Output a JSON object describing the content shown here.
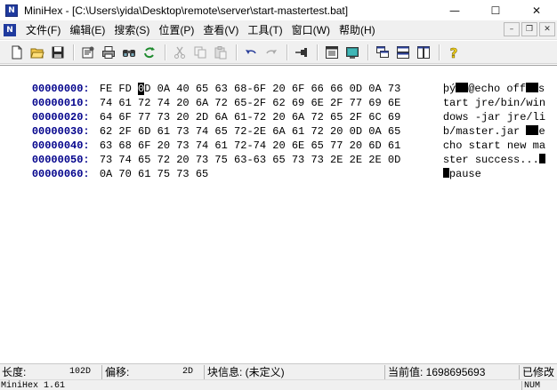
{
  "app": {
    "icon_letter": "N",
    "title": "MiniHex - [C:\\Users\\yida\\Desktop\\remote\\server\\start-mastertest.bat]",
    "controls": {
      "minimize": "—",
      "maximize": "☐",
      "close": "✕"
    }
  },
  "menu": {
    "items": [
      {
        "label": "文件(F)"
      },
      {
        "label": "编辑(E)"
      },
      {
        "label": "搜索(S)"
      },
      {
        "label": "位置(P)"
      },
      {
        "label": "查看(V)"
      },
      {
        "label": "工具(T)"
      },
      {
        "label": "窗口(W)"
      },
      {
        "label": "帮助(H)"
      }
    ],
    "mdi_controls": {
      "minimize": "–",
      "restore": "❐",
      "close": "✕"
    }
  },
  "toolbar": {
    "buttons": [
      {
        "icon": "new-file-icon"
      },
      {
        "icon": "open-folder-icon"
      },
      {
        "icon": "save-icon"
      },
      {
        "icon": "properties-icon"
      },
      {
        "icon": "print-icon"
      },
      {
        "icon": "find-icon"
      },
      {
        "icon": "refresh-icon"
      },
      {
        "icon": "cut-icon"
      },
      {
        "icon": "copy-icon"
      },
      {
        "icon": "paste-icon"
      },
      {
        "icon": "undo-icon"
      },
      {
        "icon": "redo-icon"
      },
      {
        "icon": "pin-icon"
      },
      {
        "icon": "view-list-icon"
      },
      {
        "icon": "display-icon"
      },
      {
        "icon": "cascade-icon"
      },
      {
        "icon": "tile-horizontal-icon"
      },
      {
        "icon": "tile-vertical-icon"
      },
      {
        "icon": "help-icon"
      }
    ]
  },
  "hex": {
    "rows": [
      {
        "offset": "00000000:",
        "bytes": "FE FD 0D 0A 40 65 63 68-6F 20 6F 66 66 0D 0A 73",
        "ascii": "@echo off",
        "ascii_end": "s"
      },
      {
        "offset": "00000010:",
        "bytes": "74 61 72 74 20 6A 72 65-2F 62 69 6E 2F 77 69 6E",
        "ascii": "tart jre/bin/win"
      },
      {
        "offset": "00000020:",
        "bytes": "64 6F 77 73 20 2D 6A 61-72 20 6A 72 65 2F 6C 69",
        "ascii": "dows -jar jre/li"
      },
      {
        "offset": "00000030:",
        "bytes": "62 2F 6D 61 73 74 65 72-2E 6A 61 72 20 0D 0A 65",
        "ascii": "b/master.jar ",
        "ascii_end": "e"
      },
      {
        "offset": "00000040:",
        "bytes": "63 68 6F 20 73 74 61 72-74 20 6E 65 77 20 6D 61",
        "ascii": "cho start new ma"
      },
      {
        "offset": "00000050:",
        "bytes": "73 74 65 72 20 73 75 63-63 65 73 73 2E 2E 2E 0D",
        "ascii": "ster success..."
      },
      {
        "offset": "00000060:",
        "bytes": "0A 70 61 75 73 65",
        "ascii": "pause"
      }
    ],
    "first_row": {
      "byte_1": "FE",
      "byte_2": "FD",
      "cursor_byte_head": "0",
      "cursor_byte_tail": "D",
      "bytes_rest": "0A 40 65 63 68-6F 20 6F 66 66 0D 0A 73",
      "ascii_1": "þ",
      "ascii_2": "ý"
    }
  },
  "status": {
    "length_label": "长度:",
    "length_value": "102D",
    "offset_label": "偏移:",
    "offset_value": "2D",
    "block_label": "块信息: (未定义)",
    "current_label": "当前值: 1698695693",
    "modified_label": "已修改"
  },
  "status2": {
    "version": "MiniHex 1.61",
    "num": "NUM"
  }
}
